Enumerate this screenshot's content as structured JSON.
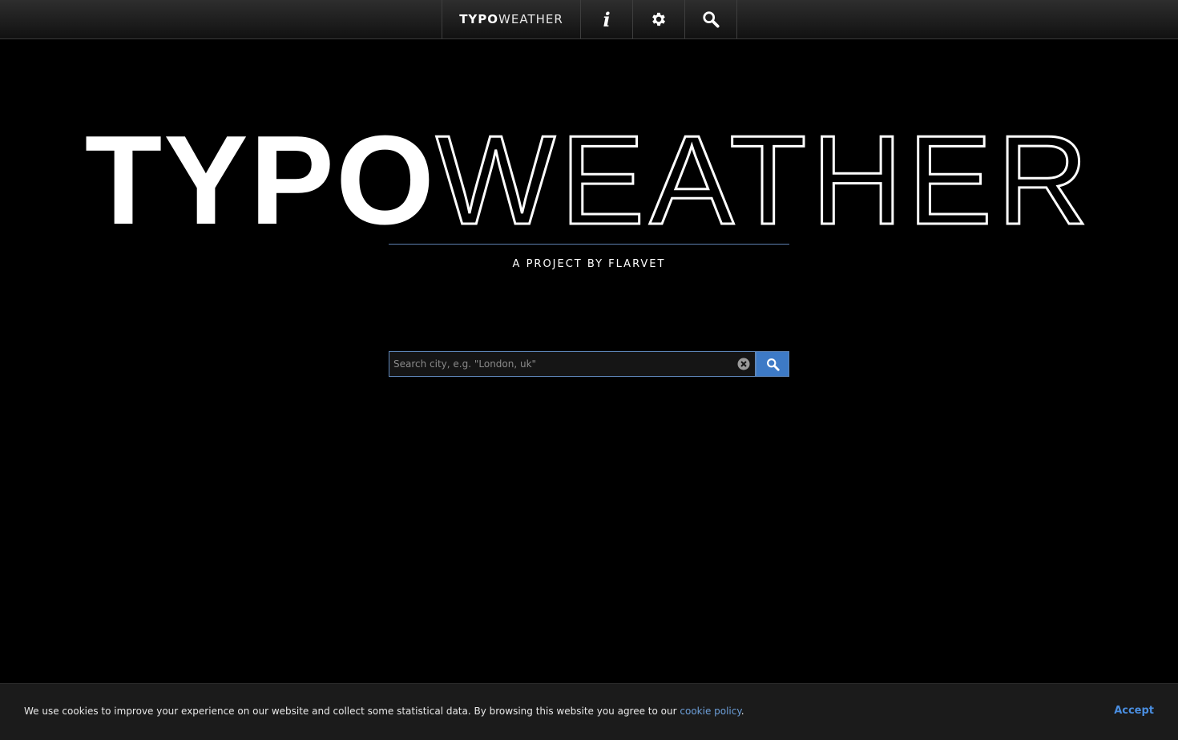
{
  "nav": {
    "brand_bold": "TYPO",
    "brand_light": "WEATHER",
    "info_icon": "info-icon",
    "settings_icon": "gear-icon",
    "search_icon": "search-icon"
  },
  "hero": {
    "title_bold": "TYPO",
    "title_thin": "WEATHER",
    "subtitle": "A PROJECT BY FLARVET"
  },
  "search": {
    "placeholder": "Search city, e.g. \"London, uk\"",
    "value": "",
    "clear_icon": "clear-icon",
    "submit_icon": "search-icon"
  },
  "cookie": {
    "text": "We use cookies to improve your experience on our website and collect some statistical data. By browsing this website you agree to our ",
    "link_text": "cookie policy",
    "trailing": ".",
    "accept_label": "Accept"
  },
  "colors": {
    "background": "#000000",
    "accent_blue": "#3d7ac6",
    "divider": "#5d7fb0",
    "link": "#6d9fd9"
  }
}
